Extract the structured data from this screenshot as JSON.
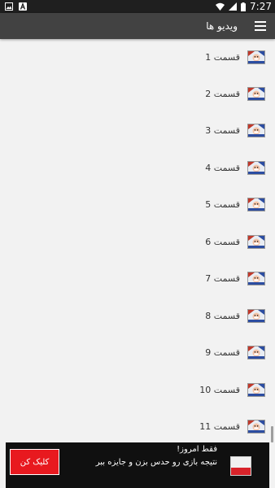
{
  "status_bar": {
    "time": "7:27",
    "left_icons": [
      "image-notification-icon",
      "letter-a-notification-icon"
    ],
    "right_icons": [
      "wifi-icon",
      "cellular-signal-icon",
      "battery-icon"
    ]
  },
  "app_bar": {
    "title": "ویدیو ها",
    "menu_icon": "hamburger-menu-icon",
    "background": "#424242"
  },
  "episodes": [
    {
      "label": "قسمت 1"
    },
    {
      "label": "قسمت 2"
    },
    {
      "label": "قسمت 3"
    },
    {
      "label": "قسمت 4"
    },
    {
      "label": "قسمت 5"
    },
    {
      "label": "قسمت 6"
    },
    {
      "label": "قسمت 7"
    },
    {
      "label": "قسمت 8"
    },
    {
      "label": "قسمت 9"
    },
    {
      "label": "قسمت 10"
    },
    {
      "label": "قسمت 11"
    }
  ],
  "ad": {
    "cta_label": "کلیک کن",
    "headline": "فقط امروز!",
    "body": "نتیجه بازی رو حدس بزن و جایزه ببر",
    "cta_color": "#e8191f"
  }
}
